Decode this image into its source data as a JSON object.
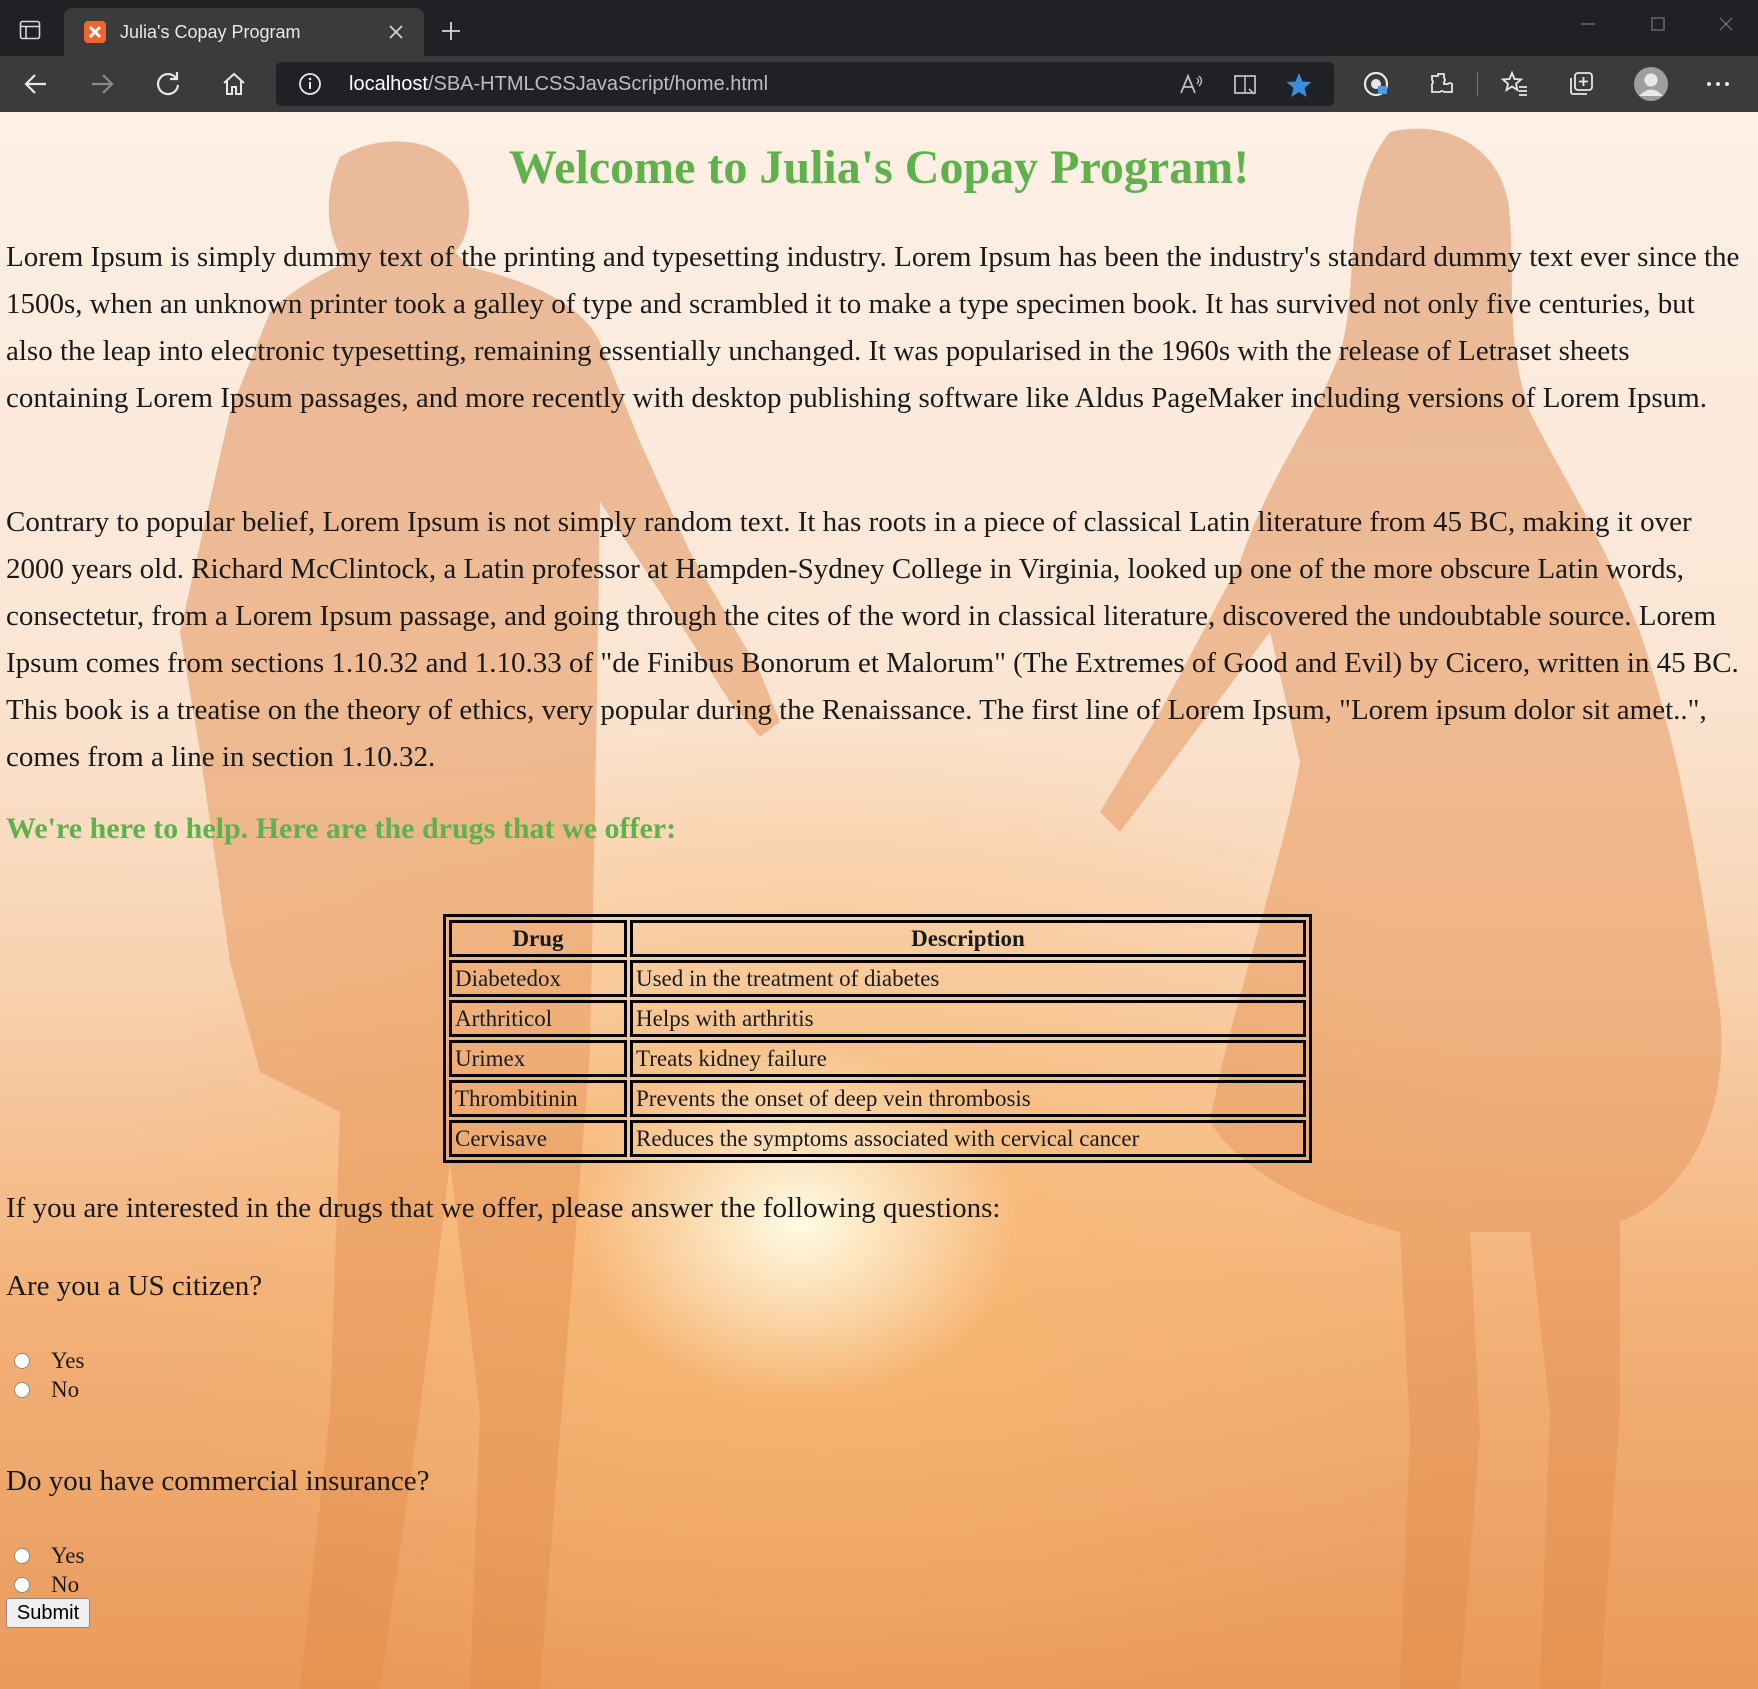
{
  "browser": {
    "tab_title": "Julia's Copay Program",
    "url_host": "localhost",
    "url_path": "/SBA-HTMLCSSJavaScript/home.html",
    "accent_color": "#3b8ede"
  },
  "page": {
    "heading": "Welcome to Julia's Copay Program!",
    "paragraph1": "Lorem Ipsum is simply dummy text of the printing and typesetting industry. Lorem Ipsum has been the industry's standard dummy text ever since the 1500s, when an unknown printer took a galley of type and scrambled it to make a type specimen book. It has survived not only five centuries, but also the leap into electronic typesetting, remaining essentially unchanged. It was popularised in the 1960s with the release of Letraset sheets containing Lorem Ipsum passages, and more recently with desktop publishing software like Aldus PageMaker including versions of Lorem Ipsum.",
    "paragraph2": "Contrary to popular belief, Lorem Ipsum is not simply random text. It has roots in a piece of classical Latin literature from 45 BC, making it over 2000 years old. Richard McClintock, a Latin professor at Hampden-Sydney College in Virginia, looked up one of the more obscure Latin words, consectetur, from a Lorem Ipsum passage, and going through the cites of the word in classical literature, discovered the undoubtable source. Lorem Ipsum comes from sections 1.10.32 and 1.10.33 of \"de Finibus Bonorum et Malorum\" (The Extremes of Good and Evil) by Cicero, written in 45 BC. This book is a treatise on the theory of ethics, very popular during the Renaissance. The first line of Lorem Ipsum, \"Lorem ipsum dolor sit amet..\", comes from a line in section 1.10.32.",
    "offer_heading": "We're here to help. Here are the drugs that we offer:",
    "heading_color": "#5fb14c",
    "table": {
      "headers": [
        "Drug",
        "Description"
      ],
      "rows": [
        [
          "Diabetedox",
          "Used in the treatment of diabetes"
        ],
        [
          "Arthriticol",
          "Helps with arthritis"
        ],
        [
          "Urimex",
          "Treats kidney failure"
        ],
        [
          "Thrombitinin",
          "Prevents the onset of deep vein thrombosis"
        ],
        [
          "Cervisave",
          "Reduces the symptoms associated with cervical cancer"
        ]
      ]
    },
    "intro_question": "If you are interested in the drugs that we offer, please answer the following questions:",
    "question1": "Are you a US citizen?",
    "question2": "Do you have commercial insurance?",
    "options": [
      "Yes",
      "No"
    ],
    "submit_label": "Submit"
  }
}
